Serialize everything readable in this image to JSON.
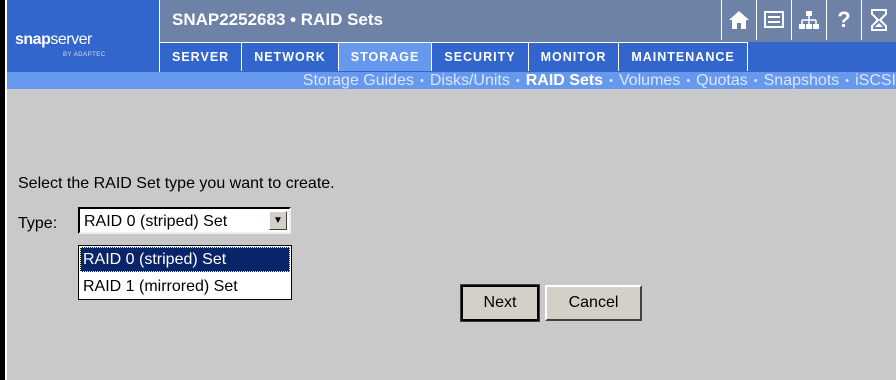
{
  "brand": {
    "logo_main": "snap",
    "logo_rest": "server",
    "logo_sub": "BY ADAPTEC"
  },
  "header": {
    "title": "SNAP2252683 • RAID Sets",
    "icons": [
      "home-icon",
      "screen-icon",
      "network-icon",
      "help-icon",
      "hourglass-icon"
    ]
  },
  "nav": {
    "tabs": [
      {
        "label": "SERVER"
      },
      {
        "label": "NETWORK"
      },
      {
        "label": "STORAGE",
        "active": true
      },
      {
        "label": "SECURITY"
      },
      {
        "label": "MONITOR"
      },
      {
        "label": "MAINTENANCE"
      }
    ]
  },
  "subnav": {
    "items": [
      {
        "label": "Storage Guides"
      },
      {
        "label": "Disks/Units"
      },
      {
        "label": "RAID Sets",
        "current": true
      },
      {
        "label": "Volumes"
      },
      {
        "label": "Quotas"
      },
      {
        "label": "Snapshots"
      },
      {
        "label": "iSCSI"
      }
    ]
  },
  "form": {
    "prompt": "Select the RAID Set type you want to create.",
    "type_label": "Type:",
    "selected_value": "RAID 0 (striped) Set",
    "options": [
      "RAID 0 (striped) Set",
      "RAID 1 (mirrored) Set"
    ],
    "next_label": "Next",
    "cancel_label": "Cancel"
  },
  "colors": {
    "brand_blue": "#3366cc",
    "title_bar": "#6d82a6",
    "subnav_blue": "#6699ee",
    "page_bg": "#c9c9c9",
    "selection": "#0a246a"
  }
}
